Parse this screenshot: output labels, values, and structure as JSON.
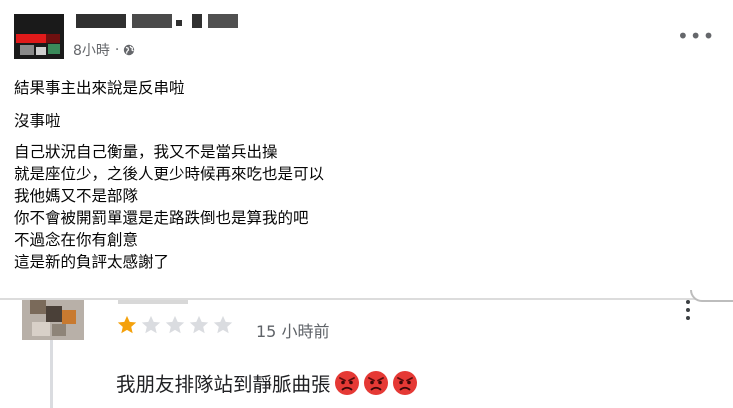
{
  "post": {
    "time": "8小時",
    "separator": "·",
    "more_label": "•••",
    "lines": [
      "結果事主出來說是反串啦",
      "沒事啦",
      "自己狀況自己衡量，我又不是當兵出操",
      "就是座位少，之後人更少時候再來吃也是可以",
      "我他媽又不是部隊",
      "你不會被開罰單還是走路跌倒也是算我的吧",
      "不過念在你有創意",
      "這是新的負評太感謝了"
    ]
  },
  "review": {
    "rating": 1,
    "max_rating": 5,
    "time": "15 小時前",
    "text": "我朋友排隊站到靜脈曲張",
    "emoji_count": 3,
    "colors": {
      "star_filled": "#f4a10c",
      "star_empty": "#dadce0",
      "emoji": "#e53935"
    }
  }
}
